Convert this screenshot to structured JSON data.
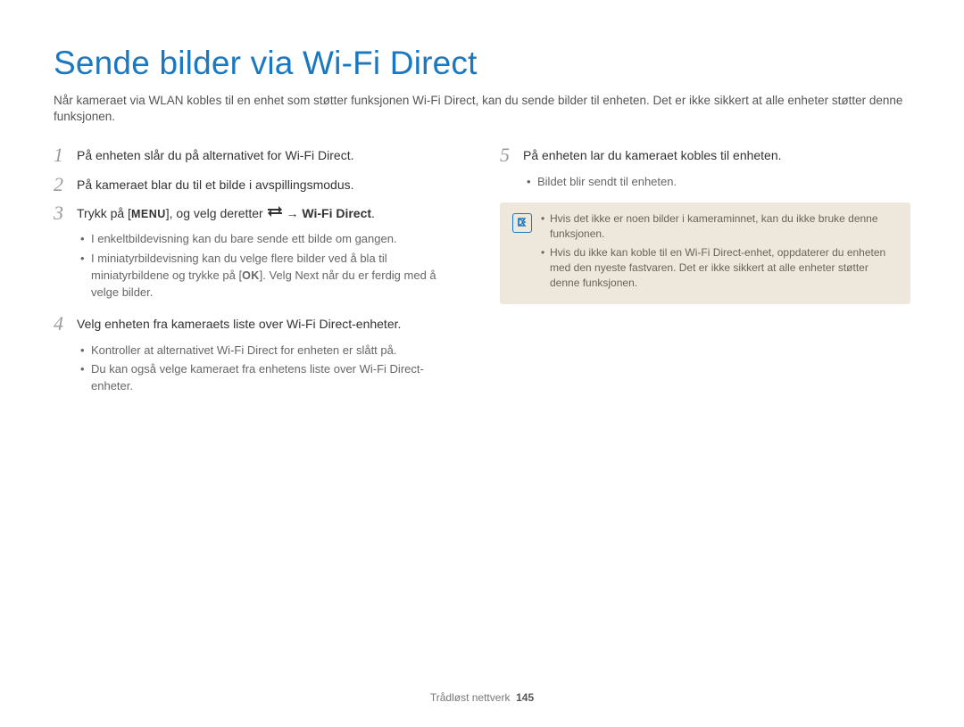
{
  "title": "Sende bilder via Wi-Fi Direct",
  "intro": "Når kameraet via WLAN kobles til en enhet som støtter funksjonen Wi-Fi Direct, kan du sende bilder til enheten. Det er ikke sikkert at alle enheter støtter denne funksjonen.",
  "left": {
    "step1": {
      "num": "1",
      "text": "På enheten slår du på alternativet for Wi-Fi Direct."
    },
    "step2": {
      "num": "2",
      "text": "På kameraet blar du til et bilde i avspillingsmodus."
    },
    "step3": {
      "num": "3",
      "pre": "Trykk på [",
      "menu": "MENU",
      "mid": "], og velg deretter ",
      "arrow": " → ",
      "target": "Wi-Fi Direct",
      "post": ".",
      "bullets": [
        "I enkeltbildevisning kan du bare sende ett bilde om gangen.",
        "I miniatyrbildevisning kan du velge flere bilder ved å bla til miniatyrbildene og trykke på [OK]. Velg Next når du er ferdig med å velge bilder."
      ],
      "b2_pre": "I miniatyrbildevisning kan du velge flere bilder ved å bla til miniatyrbildene og trykke på [",
      "b2_ok": "OK",
      "b2_mid": "]. Velg ",
      "b2_next": "Next",
      "b2_post": " når du er ferdig med å velge bilder."
    },
    "step4": {
      "num": "4",
      "text": "Velg enheten fra kameraets liste over Wi-Fi Direct-enheter.",
      "bullets": [
        "Kontroller at alternativet Wi-Fi Direct for enheten er slått på.",
        "Du kan også velge kameraet fra enhetens liste over Wi-Fi Direct-enheter."
      ]
    }
  },
  "right": {
    "step5": {
      "num": "5",
      "text": "På enheten lar du kameraet kobles til enheten.",
      "bullets": [
        "Bildet blir sendt til enheten."
      ]
    },
    "notes": [
      "Hvis det ikke er noen bilder i kameraminnet, kan du ikke bruke denne funksjonen.",
      "Hvis du ikke kan koble til en Wi-Fi Direct-enhet, oppdaterer du enheten med den nyeste fastvaren. Det er ikke sikkert at alle enheter støtter denne funksjonen."
    ]
  },
  "footer": {
    "section": "Trådløst nettverk",
    "page": "145"
  }
}
